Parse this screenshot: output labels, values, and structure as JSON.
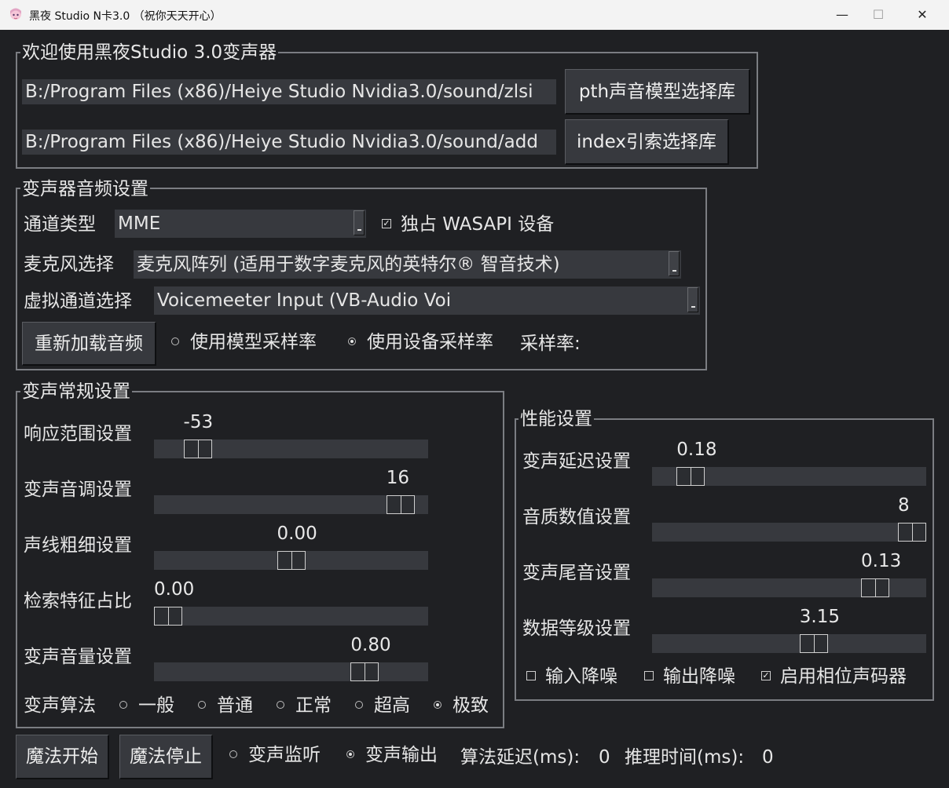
{
  "window": {
    "title": "黑夜 Studio N卡3.0 （祝你天天开心）",
    "controls": {
      "minimize": "—",
      "maximize": "☐",
      "close": "✕"
    }
  },
  "welcome": {
    "legend": "欢迎使用黑夜Studio 3.0变声器",
    "pth_path": "B:/Program Files (x86)/Heiye Studio Nvidia3.0/sound/zlsi",
    "pth_button": "pth声音模型选择库",
    "index_path": "B:/Program Files (x86)/Heiye Studio Nvidia3.0/sound/add",
    "index_button": "index引索选择库"
  },
  "audio": {
    "legend": "变声器音频设置",
    "channel_label": "通道类型",
    "channel_value": "MME",
    "wasapi_label": "独占 WASAPI 设备",
    "wasapi_checked": true,
    "mic_label": "麦克风选择",
    "mic_value": "麦克风阵列 (适用于数字麦克风的英特尔® 智音技术)",
    "virtual_label": "虚拟通道选择",
    "virtual_value": "Voicemeeter Input (VB-Audio Voi",
    "reload_button": "重新加载音频",
    "model_rate_label": "使用模型采样率",
    "device_rate_label": "使用设备采样率",
    "device_rate_selected": true,
    "sample_rate_label": "采样率:"
  },
  "general": {
    "legend": "变声常规设置",
    "sliders": [
      {
        "label": "响应范围设置",
        "value": "-53",
        "fraction": 0.12
      },
      {
        "label": "变声音调设置",
        "value": "16",
        "fraction": 0.945
      },
      {
        "label": "声线粗细设置",
        "value": "0.00",
        "fraction": 0.5
      },
      {
        "label": "检索特征占比",
        "value": "0.00",
        "fraction": 0.0
      },
      {
        "label": "变声音量设置",
        "value": "0.80",
        "fraction": 0.8
      }
    ],
    "algo_label": "变声算法",
    "algo_options": [
      "一般",
      "普通",
      "正常",
      "超高",
      "极致"
    ],
    "algo_selected": 4
  },
  "performance": {
    "legend": "性能设置",
    "sliders": [
      {
        "label": "变声延迟设置",
        "value": "0.18",
        "fraction": 0.1
      },
      {
        "label": "音质数值设置",
        "value": "8",
        "fraction": 1.0
      },
      {
        "label": "变声尾音设置",
        "value": "0.13",
        "fraction": 0.85
      },
      {
        "label": "数据等级设置",
        "value": "3.15",
        "fraction": 0.6
      }
    ],
    "checks": [
      {
        "label": "输入降噪",
        "checked": false
      },
      {
        "label": "输出降噪",
        "checked": false
      },
      {
        "label": "启用相位声码器",
        "checked": true
      }
    ]
  },
  "bottom": {
    "start_button": "魔法开始",
    "stop_button": "魔法停止",
    "monitor_label": "变声监听",
    "output_label": "变声输出",
    "output_selected": true,
    "algo_delay_label": "算法延迟(ms):",
    "algo_delay_value": "0",
    "infer_time_label": "推理时间(ms):",
    "infer_time_value": "0"
  },
  "colors": {
    "background": "#1f2023",
    "control": "#37393e",
    "border": "#7b7d82",
    "text": "#e6e6e6",
    "titlebar": "#f3f3f3"
  },
  "icons": {
    "app": "anime-character-icon",
    "minimize": "minimize-icon",
    "maximize": "maximize-icon",
    "close": "close-icon"
  }
}
